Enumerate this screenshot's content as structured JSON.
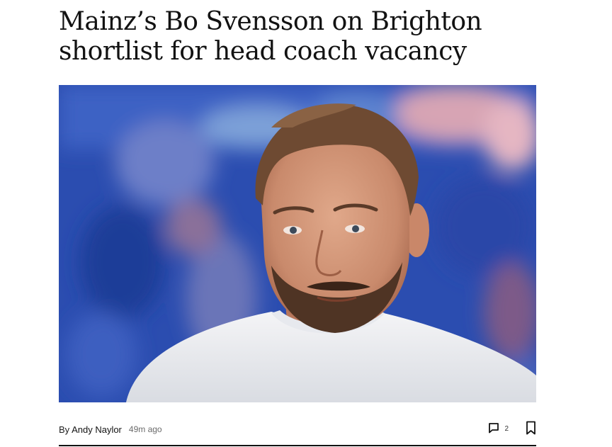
{
  "article": {
    "headline": "Mainz’s Bo Svensson on Brighton shortlist for head coach vacancy",
    "byline_prefix": "By ",
    "author": "Andy Naylor",
    "timestamp": "49m ago",
    "comment_count": "2",
    "photo_subject": "man in white t-shirt with beard, stadium background"
  },
  "icons": {
    "comments": "comment-bubble-icon",
    "bookmark": "bookmark-icon"
  },
  "colors": {
    "text": "#121212",
    "meta_gray": "#6b6b6b",
    "photo_bg_blue": "#2c4fb3"
  }
}
